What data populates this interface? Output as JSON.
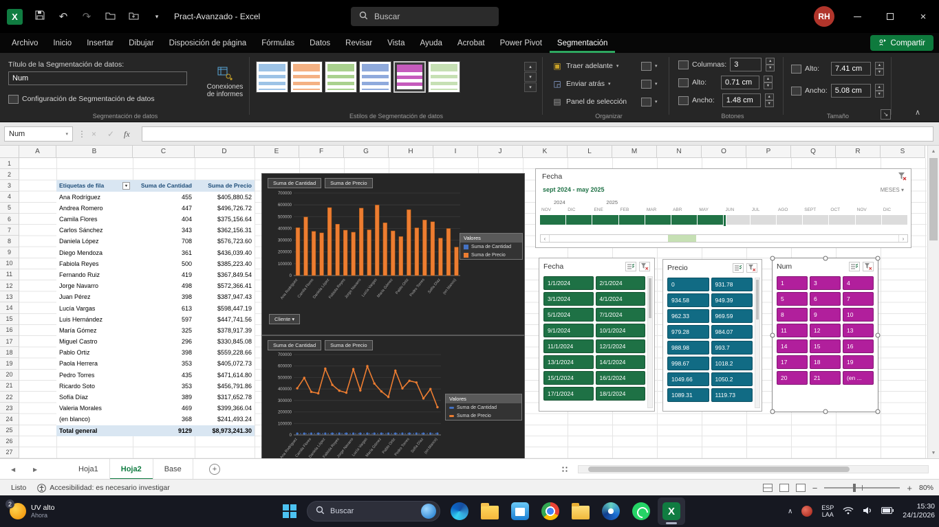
{
  "titlebar": {
    "app_title": "Pract-Avanzado - Excel",
    "search_placeholder": "Buscar",
    "avatar_initials": "RH"
  },
  "ribbon": {
    "tabs": [
      "Archivo",
      "Inicio",
      "Insertar",
      "Dibujar",
      "Disposición de página",
      "Fórmulas",
      "Datos",
      "Revisar",
      "Vista",
      "Ayuda",
      "Acrobat",
      "Power Pivot",
      "Segmentación"
    ],
    "active_tab": "Segmentación",
    "share_label": "Compartir",
    "slicer_group": {
      "caption_label": "Título de la Segmentación de datos:",
      "caption_value": "Num",
      "settings_label": "Configuración de Segmentación de datos",
      "connections_line1": "Conexiones",
      "connections_line2": "de informes",
      "group_label": "Segmentación de datos"
    },
    "styles_group": {
      "group_label": "Estilos de Segmentación de datos",
      "swatches": [
        "#9DC3E6",
        "#F4B183",
        "#A9D18E",
        "#8FAADC",
        "#C55BBC",
        "#C6E0B4"
      ],
      "selected_index": 4
    },
    "arrange_group": {
      "group_label": "Organizar",
      "bring_forward": "Traer adelante",
      "send_backward": "Enviar atrás",
      "selection_pane": "Panel de selección"
    },
    "buttons_group": {
      "group_label": "Botones",
      "columns_label": "Columnas:",
      "columns_value": "3",
      "height_label": "Alto:",
      "height_value": "0.71 cm",
      "width_label": "Ancho:",
      "width_value": "1.48 cm"
    },
    "size_group": {
      "group_label": "Tamaño",
      "height_label": "Alto:",
      "height_value": "7.41 cm",
      "width_label": "Ancho:",
      "width_value": "5.08 cm"
    }
  },
  "formula_bar": {
    "name_box_value": "Num",
    "fx_label": "fx"
  },
  "sheet": {
    "columns": [
      "A",
      "B",
      "C",
      "D",
      "E",
      "F",
      "G",
      "H",
      "I",
      "J",
      "K",
      "L",
      "M",
      "N",
      "O",
      "P",
      "Q",
      "R",
      "S"
    ],
    "row_count": 27
  },
  "pivot": {
    "headers": [
      "Etiquetas de fila",
      "Suma de Cantidad",
      "Suma de Precio"
    ],
    "rows": [
      [
        "Ana Rodríguez",
        "455",
        "$405,880.52"
      ],
      [
        "Andrea Romero",
        "447",
        "$496,726.72"
      ],
      [
        "Camila Flores",
        "404",
        "$375,156.64"
      ],
      [
        "Carlos Sánchez",
        "343",
        "$362,156.31"
      ],
      [
        "Daniela López",
        "708",
        "$576,723.60"
      ],
      [
        "Diego Mendoza",
        "361",
        "$436,039.40"
      ],
      [
        "Fabiola Reyes",
        "500",
        "$385,223.40"
      ],
      [
        "Fernando Ruiz",
        "419",
        "$367,849.54"
      ],
      [
        "Jorge Navarro",
        "498",
        "$572,366.41"
      ],
      [
        "Juan Pérez",
        "398",
        "$387,947.43"
      ],
      [
        "Lucía Vargas",
        "613",
        "$598,447.19"
      ],
      [
        "Luis Hernández",
        "597",
        "$447,741.56"
      ],
      [
        "María Gómez",
        "325",
        "$378,917.39"
      ],
      [
        "Miguel Castro",
        "296",
        "$330,845.08"
      ],
      [
        "Pablo Ortiz",
        "398",
        "$559,228.66"
      ],
      [
        "Paola Herrera",
        "353",
        "$405,072.73"
      ],
      [
        "Pedro Torres",
        "435",
        "$471,614.80"
      ],
      [
        "Ricardo Soto",
        "353",
        "$456,791.86"
      ],
      [
        "Sofía Díaz",
        "389",
        "$317,652.78"
      ],
      [
        "Valeria Morales",
        "469",
        "$399,366.04"
      ],
      [
        "(en blanco)",
        "368",
        "$241,493.24"
      ]
    ],
    "total_row": [
      "Total general",
      "9129",
      "$8,973,241.30"
    ]
  },
  "chart_data": [
    {
      "type": "bar",
      "field_buttons": [
        "Suma de Cantidad",
        "Suma de Precio"
      ],
      "axis_field_button": "Cliente",
      "legend_title": "Valores",
      "categories": [
        "Ana Rodríguez",
        "Andrea Romero",
        "Camila Flores",
        "Carlos Sánchez",
        "Daniela López",
        "Diego Mendoza",
        "Fabiola Reyes",
        "Fernando Ruiz",
        "Jorge Navarro",
        "Juan Pérez",
        "Lucía Vargas",
        "Luis Hernández",
        "María Gómez",
        "Miguel Castro",
        "Pablo Ortiz",
        "Paola Herrera",
        "Pedro Torres",
        "Ricardo Soto",
        "Sofía Díaz",
        "Valeria Morales",
        "(en blanco)"
      ],
      "series": [
        {
          "name": "Suma de Cantidad",
          "color": "#4472C4",
          "values": [
            455,
            447,
            404,
            343,
            708,
            361,
            500,
            419,
            498,
            398,
            613,
            597,
            325,
            296,
            398,
            353,
            435,
            353,
            389,
            469,
            368
          ]
        },
        {
          "name": "Suma de Precio",
          "color": "#ED7D31",
          "values": [
            405880.52,
            496726.72,
            375156.64,
            362156.31,
            576723.6,
            436039.4,
            385223.4,
            367849.54,
            572366.41,
            387947.43,
            598447.19,
            447741.56,
            378917.39,
            330845.08,
            559228.66,
            405072.73,
            471614.8,
            456791.86,
            317652.78,
            399366.04,
            241493.24
          ]
        }
      ],
      "ylim": [
        0,
        700000
      ],
      "ytick_step": 100000
    },
    {
      "type": "line",
      "field_buttons": [
        "Suma de Cantidad",
        "Suma de Precio"
      ],
      "legend_title": "Valores",
      "categories": [
        "Ana Rodríguez",
        "Andrea Romero",
        "Camila Flores",
        "Carlos Sánchez",
        "Daniela López",
        "Diego Mendoza",
        "Fabiola Reyes",
        "Fernando Ruiz",
        "Jorge Navarro",
        "Juan Pérez",
        "Lucía Vargas",
        "Luis Hernández",
        "María Gómez",
        "Miguel Castro",
        "Pablo Ortiz",
        "Paola Herrera",
        "Pedro Torres",
        "Ricardo Soto",
        "Sofía Díaz",
        "Valeria Morales",
        "(en blanco)"
      ],
      "series": [
        {
          "name": "Suma de Cantidad",
          "color": "#4472C4",
          "values": [
            455,
            447,
            404,
            343,
            708,
            361,
            500,
            419,
            498,
            398,
            613,
            597,
            325,
            296,
            398,
            353,
            435,
            353,
            389,
            469,
            368
          ]
        },
        {
          "name": "Suma de Precio",
          "color": "#ED7D31",
          "values": [
            405880.52,
            496726.72,
            375156.64,
            362156.31,
            576723.6,
            436039.4,
            385223.4,
            367849.54,
            572366.41,
            387947.43,
            598447.19,
            447741.56,
            378917.39,
            330845.08,
            559228.66,
            405072.73,
            471614.8,
            456791.86,
            317652.78,
            399366.04,
            241493.24
          ]
        }
      ],
      "ylim": [
        0,
        700000
      ],
      "ytick_step": 100000
    }
  ],
  "timeline": {
    "title": "Fecha",
    "range_label": "sept 2024 - may 2025",
    "period_label": "MESES",
    "year_groups": [
      {
        "year": "2024",
        "months": [
          "NOV",
          "DIC"
        ]
      },
      {
        "year": "2025",
        "months": [
          "ENE",
          "FEB",
          "MAR",
          "ABR",
          "MAY",
          "JUN",
          "JUL",
          "AGO",
          "SEPT",
          "OCT",
          "NOV",
          "DIC"
        ]
      }
    ],
    "selected_month_count": 7
  },
  "slicers": [
    {
      "title": "Fecha",
      "columns": 2,
      "color": "#1E7145",
      "has_scrollbar": true,
      "selected_shape": false,
      "items": [
        "1/1/2024",
        "2/1/2024",
        "3/1/2024",
        "4/1/2024",
        "5/1/2024",
        "7/1/2024",
        "9/1/2024",
        "10/1/2024",
        "11/1/2024",
        "12/1/2024",
        "13/1/2024",
        "14/1/2024",
        "15/1/2024",
        "16/1/2024",
        "17/1/2024",
        "18/1/2024"
      ]
    },
    {
      "title": "Precio",
      "columns": 2,
      "color": "#116B84",
      "has_scrollbar": true,
      "selected_shape": false,
      "items": [
        "0",
        "931.78",
        "934.58",
        "949.39",
        "962.33",
        "969.59",
        "979.28",
        "984.07",
        "988.98",
        "993.7",
        "998.67",
        "1018.2",
        "1049.66",
        "1050.2",
        "1089.31",
        "1119.73"
      ]
    },
    {
      "title": "Num",
      "columns": 3,
      "color": "#B11F9C",
      "has_scrollbar": false,
      "selected_shape": true,
      "items": [
        "1",
        "3",
        "4",
        "5",
        "6",
        "7",
        "8",
        "9",
        "10",
        "11",
        "12",
        "13",
        "14",
        "15",
        "16",
        "17",
        "18",
        "19",
        "20",
        "21",
        "(en ..."
      ]
    }
  ],
  "sheet_tabs": {
    "tabs": [
      "Hoja1",
      "Hoja2",
      "Base"
    ],
    "active_tab": "Hoja2"
  },
  "status_bar": {
    "mode": "Listo",
    "accessibility": "Accesibilidad: es necesario investigar",
    "zoom": "80%"
  },
  "taskbar": {
    "widget": {
      "badge": "2",
      "line1": "UV alto",
      "line2": "Ahora"
    },
    "search_placeholder": "Buscar",
    "apps": [
      "edge",
      "file-explorer",
      "store",
      "chrome",
      "folder",
      "browser",
      "whatsapp",
      "excel"
    ],
    "active_app": "excel",
    "tray": {
      "lang_line1": "ESP",
      "lang_line2": "LAA",
      "time": "15:30",
      "date": "24/1/2026"
    }
  }
}
